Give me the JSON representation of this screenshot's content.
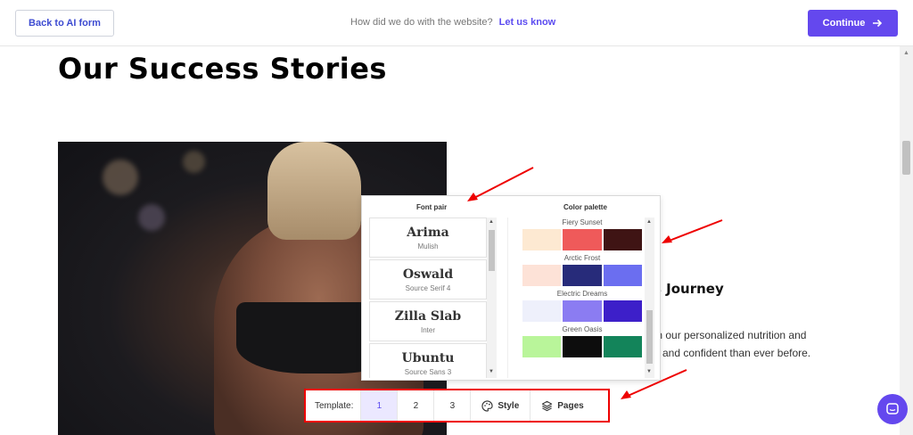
{
  "topbar": {
    "back_label": "Back to AI form",
    "feedback_question": "How did we do with the website?",
    "feedback_link": "Let us know",
    "continue_label": "Continue"
  },
  "page": {
    "heading": "Our Success Stories",
    "story_title_partial": "s Journey",
    "story_line1": "th our personalized nutrition and",
    "story_line2": "d and confident than ever before."
  },
  "panel": {
    "font_header": "Font pair",
    "palette_header": "Color palette",
    "fonts": [
      {
        "main": "Arima",
        "sub": "Mulish"
      },
      {
        "main": "Oswald",
        "sub": "Source Serif 4"
      },
      {
        "main": "Zilla Slab",
        "sub": "Inter"
      },
      {
        "main": "Ubuntu",
        "sub": "Source Sans 3"
      }
    ],
    "palettes": [
      {
        "name": "Fiery Sunset",
        "colors": [
          "#fde9d2",
          "#ef5a5a",
          "#3f1414"
        ]
      },
      {
        "name": "Arctic Frost",
        "colors": [
          "#fde2d7",
          "#272b7a",
          "#6b6ef0"
        ]
      },
      {
        "name": "Electric Dreams",
        "colors": [
          "#eef0fb",
          "#8b7cf2",
          "#3d1fc9"
        ]
      },
      {
        "name": "Green Oasis",
        "colors": [
          "#b9f59a",
          "#0d0d0d",
          "#13845a"
        ]
      }
    ]
  },
  "toolbar": {
    "template_label": "Template:",
    "templates": [
      "1",
      "2",
      "3"
    ],
    "active_template": "1",
    "style_label": "Style",
    "pages_label": "Pages"
  },
  "colors": {
    "accent": "#6448ee",
    "annotation": "#e00000"
  }
}
